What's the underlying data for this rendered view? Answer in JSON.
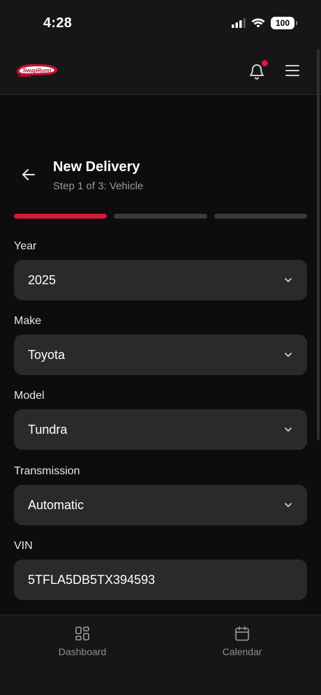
{
  "status_bar": {
    "time": "4:28",
    "battery": "100"
  },
  "header": {
    "logo_text": "SwapRunn",
    "notification_dot_color": "#e0183a"
  },
  "page": {
    "title": "New Delivery",
    "subtitle": "Step 1 of 3: Vehicle"
  },
  "progress": {
    "current_step": 1,
    "total_steps": 3,
    "accent": "#d6193a"
  },
  "form": {
    "year": {
      "label": "Year",
      "value": "2025"
    },
    "make": {
      "label": "Make",
      "value": "Toyota"
    },
    "model": {
      "label": "Model",
      "value": "Tundra"
    },
    "transmission": {
      "label": "Transmission",
      "value": "Automatic"
    },
    "vin": {
      "label": "VIN",
      "value": "5TFLA5DB5TX394593"
    }
  },
  "bottom_nav": {
    "items": [
      {
        "label": "Dashboard",
        "icon": "dashboard-grid-icon"
      },
      {
        "label": "Calendar",
        "icon": "calendar-icon"
      }
    ]
  }
}
